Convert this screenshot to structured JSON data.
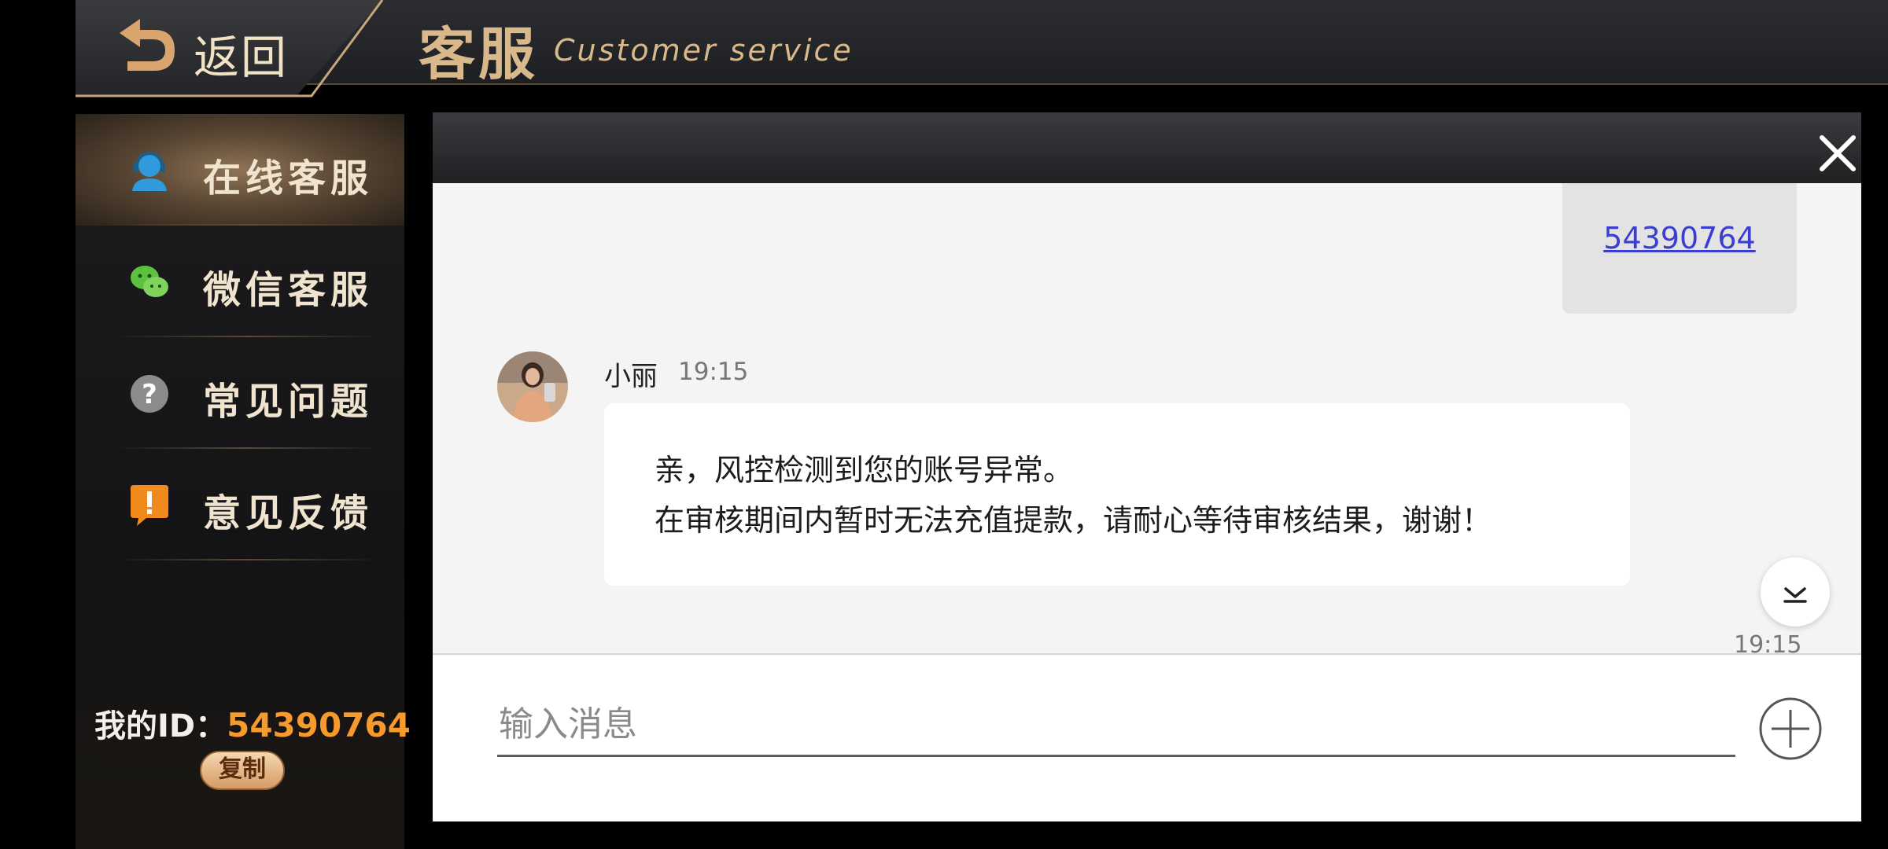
{
  "header": {
    "back_label": "返回",
    "title_cn": "客服",
    "title_en": "Customer service"
  },
  "sidebar": {
    "items": [
      {
        "label": "在线客服",
        "icon": "headset-user-icon",
        "active": true
      },
      {
        "label": "微信客服",
        "icon": "wechat-icon",
        "active": false
      },
      {
        "label": "常见问题",
        "icon": "question-icon",
        "active": false
      },
      {
        "label": "意见反馈",
        "icon": "feedback-icon",
        "active": false
      }
    ],
    "my_id_label": "我的ID：",
    "my_id_value": "54390764",
    "copy_label": "复制"
  },
  "chat": {
    "sent_message": "54390764",
    "agent": {
      "name": "小丽",
      "time": "19:15"
    },
    "received_lines": [
      "亲，风控检测到您的账号异常。",
      "在审核期间内暂时无法充值提款，请耐心等待审核结果，谢谢！"
    ],
    "bottom_time": "19:15"
  },
  "input": {
    "placeholder": "输入消息",
    "value": ""
  },
  "colors": {
    "accent_gold": "#d9b98c",
    "id_orange": "#f79a2d",
    "link_blue": "#3a3fd1"
  }
}
